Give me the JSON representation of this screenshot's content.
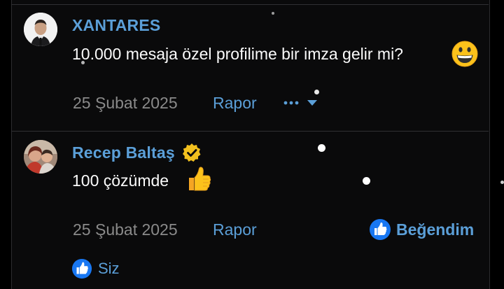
{
  "posts": [
    {
      "username": "XANTARES",
      "message": "10.000 mesaja özel profilime bir imza gelir mi?",
      "emoji": "grinning-face",
      "date": "25 Şubat 2025",
      "report_label": "Rapor",
      "more_label": "•••"
    },
    {
      "username": "Recep Baltaş",
      "verified": true,
      "message": "100 çözümde",
      "emoji": "thumbs-up",
      "date": "25 Şubat 2025",
      "report_label": "Rapor",
      "like_label": "Beğendim",
      "reaction_label": "Siz"
    }
  ],
  "colors": {
    "accent": "#5b9fd8",
    "background": "#0a0a0b",
    "muted_text": "#8a8a8a",
    "verified_badge": "#f2c01e"
  }
}
